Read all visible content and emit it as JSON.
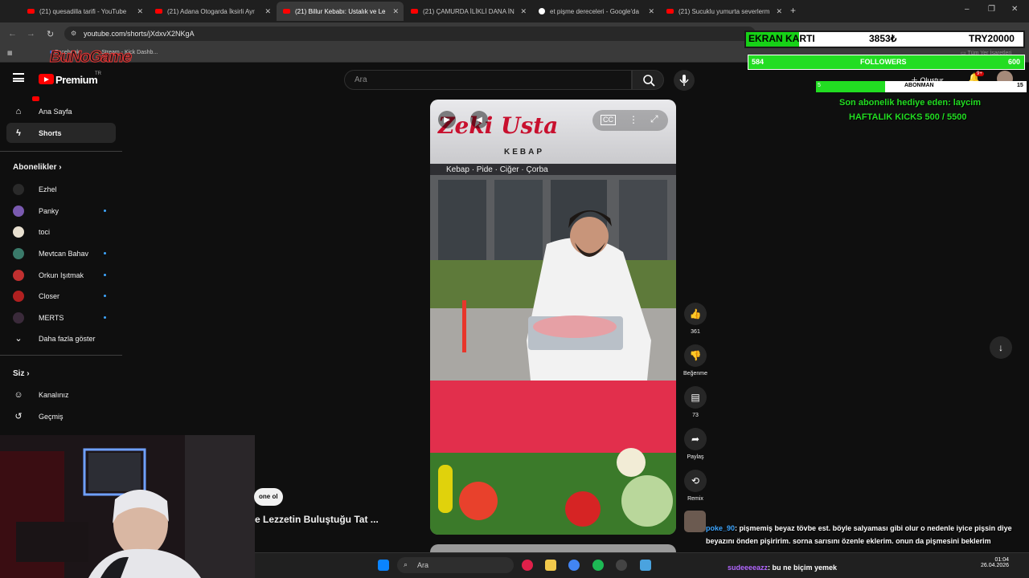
{
  "browser": {
    "tabs": [
      {
        "title": "(21) quesadilla tarifi - YouTube",
        "icon": "youtube-icon"
      },
      {
        "title": "(21) Adana Otogarda İksirli Ayr",
        "icon": "youtube-icon"
      },
      {
        "title": "(21) Billur Kebabı: Ustalık ve Le",
        "icon": "youtube-icon",
        "active": true
      },
      {
        "title": "(21) ÇAMURDA İLİKLİ DANA İN",
        "icon": "youtube-icon"
      },
      {
        "title": "et pişme dereceleri - Google'da",
        "icon": "google-icon"
      },
      {
        "title": "(21) Sucuklu yumurta severlerm",
        "icon": "youtube-icon"
      }
    ],
    "new_tab": "+",
    "url": "youtube.com/shorts/jXdxvX2NKgA",
    "bookmarks": [
      "Facebook",
      "Stream - Kick Dashb..."
    ],
    "bookmarks_right": "Tüm Yer İşaretleri",
    "window_controls": [
      "–",
      "❐",
      "✕"
    ]
  },
  "stream_logo": "BuNoGame",
  "youtube": {
    "logo_text": "Premium",
    "region": "TR",
    "search_placeholder": "Ara",
    "create_label": "Oluştur",
    "notification_badge": "9+",
    "sidebar": {
      "main": [
        {
          "label": "Ana Sayfa",
          "icon": "home-icon"
        },
        {
          "label": "Shorts",
          "icon": "shorts-icon",
          "active": true
        }
      ],
      "subscriptions_header": "Abonelikler",
      "subscriptions": [
        {
          "label": "Ezhel",
          "color": "#2a2a2a",
          "dot": false
        },
        {
          "label": "Panky",
          "color": "#7a5ab0",
          "dot": true
        },
        {
          "label": "toci",
          "color": "#e8e0d0",
          "dot": false
        },
        {
          "label": "Mevtcan Bahav",
          "color": "#3a7a6a",
          "dot": true
        },
        {
          "label": "Orkun Işıtmak",
          "color": "#c03030",
          "dot": true
        },
        {
          "label": "Closer",
          "color": "#b02020",
          "dot": true
        },
        {
          "label": "MERTS",
          "color": "#3a2a3a",
          "dot": true
        }
      ],
      "show_more": "Daha fazla göster",
      "you_header": "Siz",
      "you": [
        {
          "label": "Kanalınız",
          "icon": "channel-icon"
        },
        {
          "label": "Geçmiş",
          "icon": "history-icon"
        }
      ]
    },
    "short": {
      "brand": "Zeki Usta",
      "brand_sub": "KEBAP",
      "sign": "Kebap · Pide · Ciğer · Çorba",
      "likes": "361",
      "dislike_label": "Beğenme",
      "comments": "73",
      "share_label": "Paylaş",
      "remix_label": "Remix",
      "subscribe_label": "one ol",
      "title": "e Lezzetin Buluştuğu Tat ..."
    }
  },
  "overlay": {
    "ekran": {
      "label": "EKRAN KARTI",
      "current": "3853₺",
      "goal": "TRY20000",
      "progress": 0.19
    },
    "followers": {
      "current": "584",
      "label": "FOLLOWERS",
      "goal": "600",
      "progress": 0.97
    },
    "abone": {
      "label": "ABONMAN",
      "current": "5",
      "goal": "15",
      "progress": 0.33
    },
    "last_sub": "Son abonelik hediye eden: laycim",
    "weekly": "HAFTALIK KICKS 500 / 5500"
  },
  "chat": {
    "user1": "poke_90",
    "msg1": ": pişmemiş beyaz tövbe est. böyle salyaması gibi olur o nedenle iyice pişsin diye beyazını önden pişiririm. sorna sarısını özenle eklerim. onun da pişmesini beklerim",
    "user2": "sudeeeeazz",
    "msg2": ": bu ne biçim yemek"
  },
  "taskbar": {
    "search_placeholder": "Ara",
    "time": "01:04",
    "date": "26.04.2026"
  }
}
